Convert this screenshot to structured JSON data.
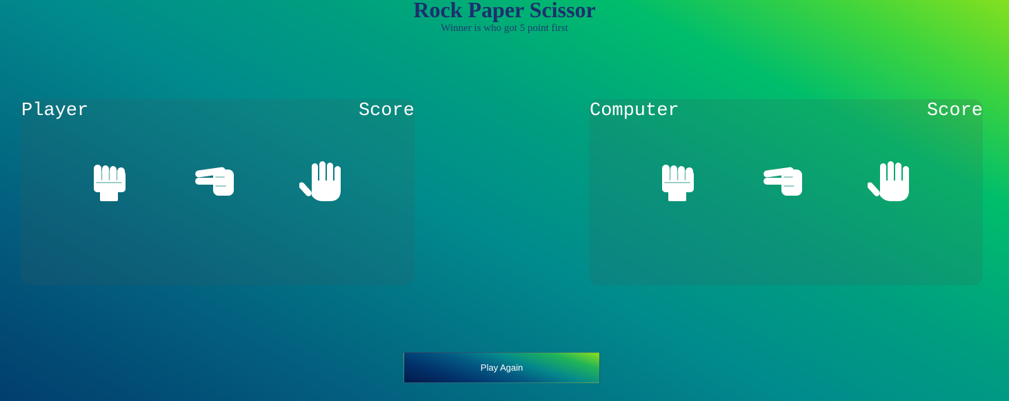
{
  "header": {
    "title": "Rock Paper Scissor",
    "subtitle": "Winner is who got 5 point first"
  },
  "player_panel": {
    "name": "Player",
    "score_label": "Score",
    "choices": [
      "rock-icon",
      "scissors-icon",
      "paper-icon"
    ]
  },
  "computer_panel": {
    "name": "Computer",
    "score_label": "Score",
    "choices": [
      "rock-icon",
      "scissors-icon",
      "paper-icon"
    ]
  },
  "controls": {
    "play_again_label": "Play Again"
  },
  "colors": {
    "title": "#1e2f6e",
    "panel_text": "#ffffff",
    "icon": "#ffffff"
  }
}
